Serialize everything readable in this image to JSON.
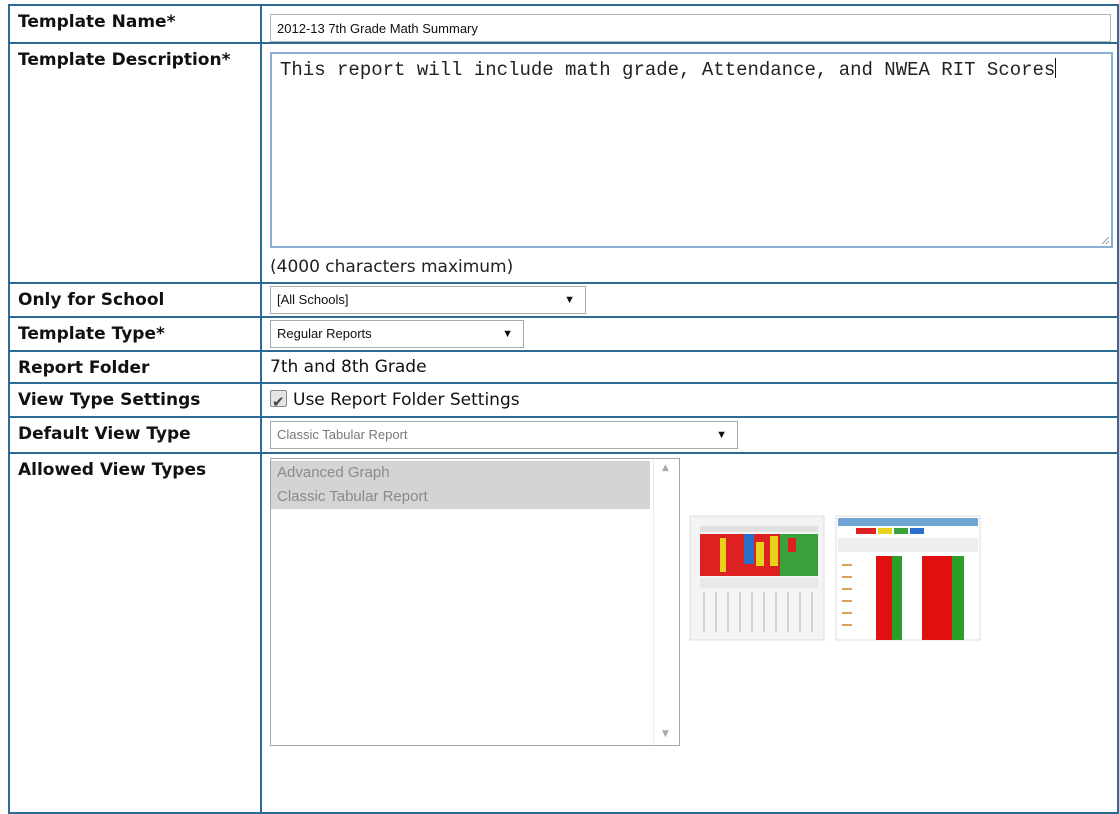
{
  "fields": {
    "template_name": {
      "label": "Template Name*",
      "value": "2012-13 7th Grade Math Summary"
    },
    "template_description": {
      "label": "Template Description*",
      "value": "This report will include math grade, Attendance, and NWEA RIT Scores",
      "hint": "(4000 characters maximum)"
    },
    "only_for_school": {
      "label": "Only for School",
      "selected": "[All Schools]"
    },
    "template_type": {
      "label": "Template Type*",
      "selected": "Regular Reports"
    },
    "report_folder": {
      "label": "Report Folder",
      "value": "7th and 8th Grade"
    },
    "view_type_settings": {
      "label": "View Type Settings",
      "checkbox_label": "Use Report Folder Settings",
      "checked": true
    },
    "default_view_type": {
      "label": "Default View Type",
      "selected": "Classic Tabular Report"
    },
    "allowed_view_types": {
      "label": "Allowed View Types",
      "options": [
        "Advanced Graph",
        "Classic Tabular Report"
      ]
    }
  },
  "icons": {
    "select_arrow": "triangle-down-icon",
    "check": "checkmark-icon",
    "scroll_up": "scroll-up-icon",
    "scroll_down": "scroll-down-icon"
  },
  "colors": {
    "border": "#2c6b95",
    "textarea_border": "#8aaed2",
    "list_selected": "#d4d4d4"
  }
}
